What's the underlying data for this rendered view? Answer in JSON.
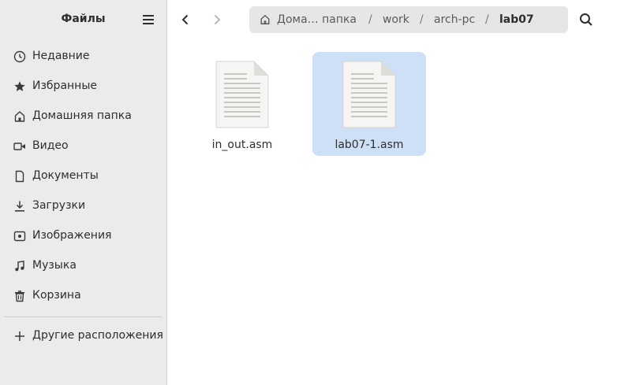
{
  "sidebar": {
    "title": "Файлы",
    "items": [
      {
        "label": "Недавние",
        "icon": "clock-icon"
      },
      {
        "label": "Избранные",
        "icon": "star-icon"
      },
      {
        "label": "Домашняя папка",
        "icon": "home-icon"
      },
      {
        "label": "Видео",
        "icon": "video-icon"
      },
      {
        "label": "Документы",
        "icon": "document-icon"
      },
      {
        "label": "Загрузки",
        "icon": "download-icon"
      },
      {
        "label": "Изображения",
        "icon": "image-icon"
      },
      {
        "label": "Музыка",
        "icon": "music-icon"
      },
      {
        "label": "Корзина",
        "icon": "trash-icon"
      }
    ],
    "other_locations": {
      "label": "Другие расположения",
      "icon": "plus-icon"
    }
  },
  "toolbar": {
    "breadcrumbs": [
      "Дома… папка",
      "work",
      "arch-pc",
      "lab07"
    ],
    "separator": "/"
  },
  "files": [
    {
      "name": "in_out.asm",
      "selected": false
    },
    {
      "name": "lab07-1.asm",
      "selected": true
    }
  ],
  "colors": {
    "sidebar_bg": "#ebebeb",
    "selection": "#cde0f6",
    "pathbar_bg": "#e6e6e6"
  }
}
